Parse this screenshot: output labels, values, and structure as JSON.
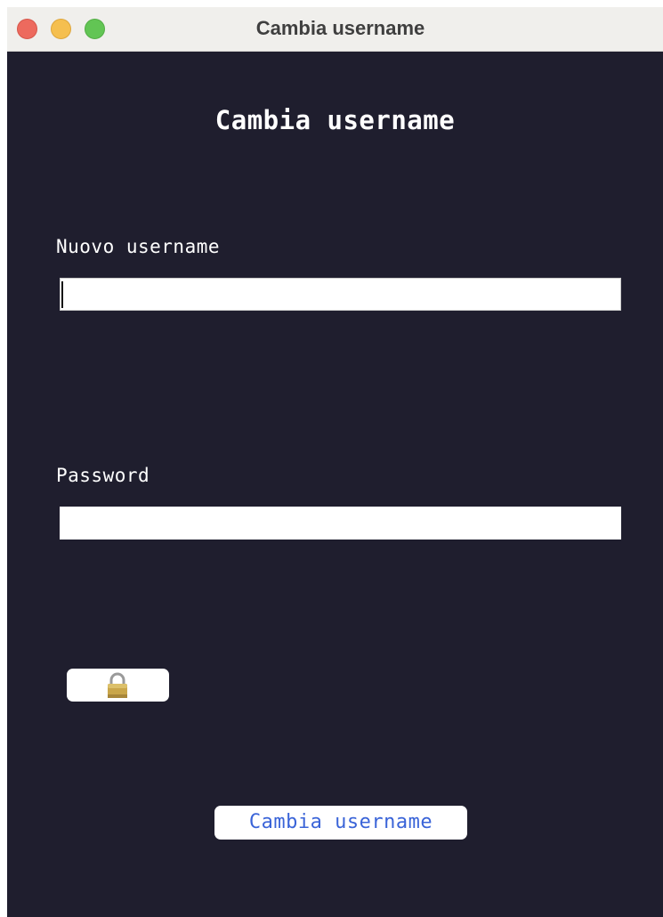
{
  "window": {
    "title": "Cambia username"
  },
  "form": {
    "heading": "Cambia username",
    "username_label": "Nuovo username",
    "username_value": "",
    "password_label": "Password",
    "password_value": "",
    "lock_icon": "lock-icon",
    "submit_label": "Cambia username"
  },
  "colors": {
    "background": "#1f1e2e",
    "titlebar": "#f0efec",
    "accent_text": "#3a64d8",
    "close": "#ed6a5e",
    "minimize": "#f5bf4f",
    "zoom": "#62c554"
  }
}
